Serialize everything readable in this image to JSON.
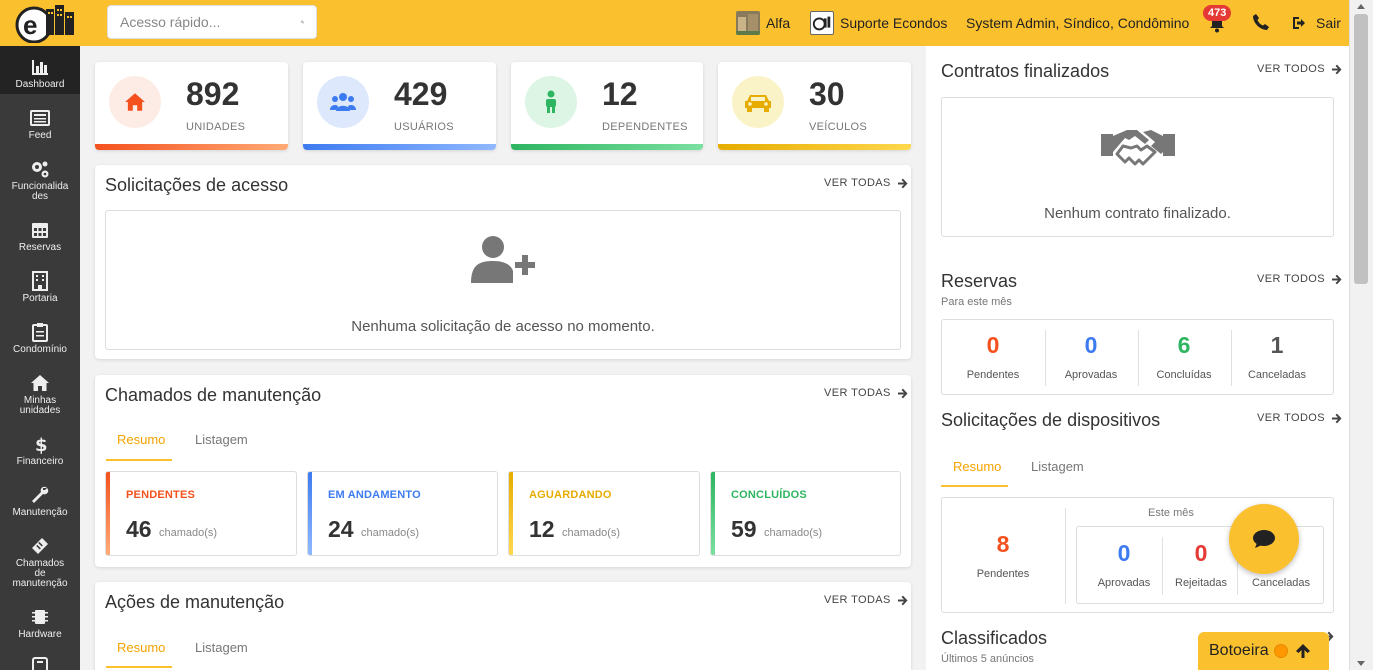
{
  "header": {
    "search_placeholder": "Acesso rápido...",
    "condo_name": "Alfa",
    "support_label": "Suporte Econdos",
    "user_info": "System Admin, Síndico, Condômino",
    "notifications_count": "473",
    "logout_label": "Sair",
    "brand_color": "#fbc02d"
  },
  "sidebar": {
    "items": [
      {
        "label": "Dashboard",
        "icon": "chart-bar-icon"
      },
      {
        "label": "Feed",
        "icon": "newspaper-icon"
      },
      {
        "label": "Funcionalida des",
        "icon": "gears-icon"
      },
      {
        "label": "Reservas",
        "icon": "calendar-icon"
      },
      {
        "label": "Portaria",
        "icon": "building-icon"
      },
      {
        "label": "Condomínio",
        "icon": "clipboard-icon"
      },
      {
        "label": "Minhas unidades",
        "icon": "home-icon"
      },
      {
        "label": "Financeiro",
        "icon": "dollar-icon"
      },
      {
        "label": "Manutenção",
        "icon": "wrench-icon"
      },
      {
        "label": "Chamados de manutenção",
        "icon": "ticket-icon"
      },
      {
        "label": "Hardware",
        "icon": "chip-icon"
      }
    ]
  },
  "stats": [
    {
      "value": "892",
      "label": "UNIDADES",
      "icon": "home-icon",
      "color": "#f4511e"
    },
    {
      "value": "429",
      "label": "USUÁRIOS",
      "icon": "users-icon",
      "color": "#3d7bf0"
    },
    {
      "value": "12",
      "label": "DEPENDENTES",
      "icon": "child-icon",
      "color": "#2db560"
    },
    {
      "value": "30",
      "label": "VEÍCULOS",
      "icon": "car-icon",
      "color": "#e6ac00"
    }
  ],
  "access_requests": {
    "title": "Solicitações de acesso",
    "link": "VER TODAS",
    "empty": "Nenhuma solicitação de acesso no momento."
  },
  "maintenance_tickets": {
    "title": "Chamados de manutenção",
    "link": "VER TODAS",
    "tabs": [
      "Resumo",
      "Listagem"
    ],
    "cards": [
      {
        "title": "PENDENTES",
        "value": "46",
        "unit": "chamado(s)",
        "color": "#f4511e"
      },
      {
        "title": "EM ANDAMENTO",
        "value": "24",
        "unit": "chamado(s)",
        "color": "#3d7bf0"
      },
      {
        "title": "AGUARDANDO",
        "value": "12",
        "unit": "chamado(s)",
        "color": "#e6ac00"
      },
      {
        "title": "CONCLUÍDOS",
        "value": "59",
        "unit": "chamado(s)",
        "color": "#2db560"
      }
    ]
  },
  "maintenance_actions": {
    "title": "Ações de manutenção",
    "link": "VER TODAS",
    "tabs": [
      "Resumo",
      "Listagem"
    ]
  },
  "contracts": {
    "title": "Contratos finalizados",
    "link": "VER TODOS",
    "empty": "Nenhum contrato finalizado."
  },
  "reservations": {
    "title": "Reservas",
    "subtitle": "Para este mês",
    "link": "VER TODOS",
    "items": [
      {
        "value": "0",
        "label": "Pendentes",
        "color": "#f4511e"
      },
      {
        "value": "0",
        "label": "Aprovadas",
        "color": "#3d7bf0"
      },
      {
        "value": "6",
        "label": "Concluídas",
        "color": "#2db560"
      },
      {
        "value": "1",
        "label": "Canceladas",
        "color": "#555555"
      }
    ]
  },
  "device_requests": {
    "title": "Solicitações de dispositivos",
    "link": "VER TODOS",
    "tabs": [
      "Resumo",
      "Listagem"
    ],
    "pending": {
      "value": "8",
      "label": "Pendentes"
    },
    "month_label": "Este mês",
    "items": [
      {
        "value": "0",
        "label": "Aprovadas",
        "color": "#3d7bf0"
      },
      {
        "value": "0",
        "label": "Rejeitadas",
        "color": "#e53935"
      },
      {
        "value": "",
        "label": "Canceladas",
        "color": "#555555"
      }
    ]
  },
  "classifieds": {
    "title": "Classificados",
    "subtitle": "Últimos 5 anúncios"
  },
  "botoeira": {
    "label": "Botoeira"
  }
}
